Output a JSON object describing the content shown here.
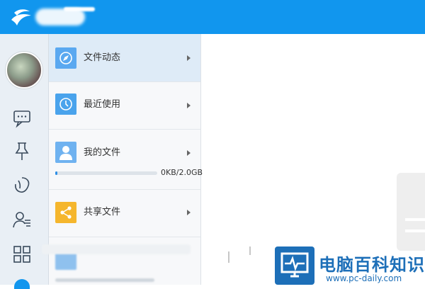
{
  "nav": {
    "items": [
      {
        "label": "文件动态",
        "icon": "compass-icon"
      },
      {
        "label": "最近使用",
        "icon": "clock-icon"
      },
      {
        "label": "我的文件",
        "icon": "user-icon"
      },
      {
        "label": "共享文件",
        "icon": "share-icon"
      }
    ],
    "storage": {
      "usage_text": "0KB/2.0GB",
      "used_fraction": 0.02
    }
  },
  "rail": {
    "icons": [
      "chat-icon",
      "pin-icon",
      "contacts-icon",
      "add-contact-icon",
      "apps-icon"
    ]
  },
  "watermark": {
    "text": "电脑百科知识",
    "url": "www.pc-daily.com"
  },
  "colors": {
    "accent": "#1196ee",
    "nav_active": "#deebf7",
    "compass_bg": "#5aa8f0",
    "clock_bg": "#4aa3ec",
    "user_bg": "#6fb2f0",
    "share_bg": "#f5b62d"
  }
}
